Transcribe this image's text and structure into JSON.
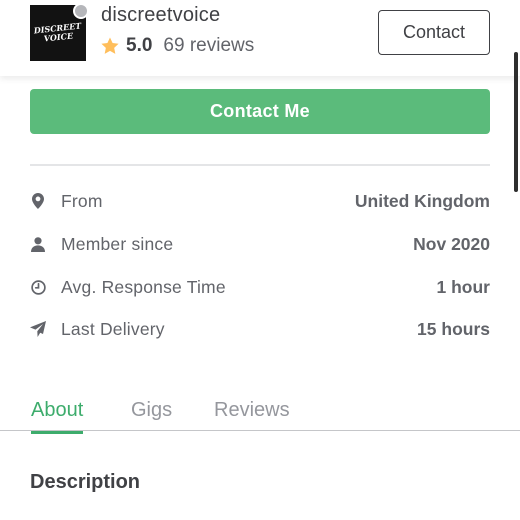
{
  "seller": {
    "avatar_text": "DISCREET VOICE",
    "username": "discreetvoice",
    "rating": "5.0",
    "reviews": "69 reviews"
  },
  "header": {
    "contact_label": "Contact"
  },
  "cta": {
    "contact_me_label": "Contact Me"
  },
  "info": [
    {
      "icon": "location-pin-icon",
      "label": "From",
      "value": "United Kingdom"
    },
    {
      "icon": "person-icon",
      "label": "Member since",
      "value": "Nov 2020"
    },
    {
      "icon": "clock-icon",
      "label": "Avg. Response Time",
      "value": "1 hour"
    },
    {
      "icon": "paper-plane-icon",
      "label": "Last Delivery",
      "value": "15 hours"
    }
  ],
  "tabs": [
    {
      "label": "About",
      "active": true
    },
    {
      "label": "Gigs",
      "active": false
    },
    {
      "label": "Reviews",
      "active": false
    }
  ],
  "description": {
    "title": "Description"
  },
  "colors": {
    "accent": "#3dac6c",
    "button_green": "#5bbb7b",
    "star": "#ffbe5b",
    "text_dark": "#404145",
    "text_muted": "#62646a"
  }
}
